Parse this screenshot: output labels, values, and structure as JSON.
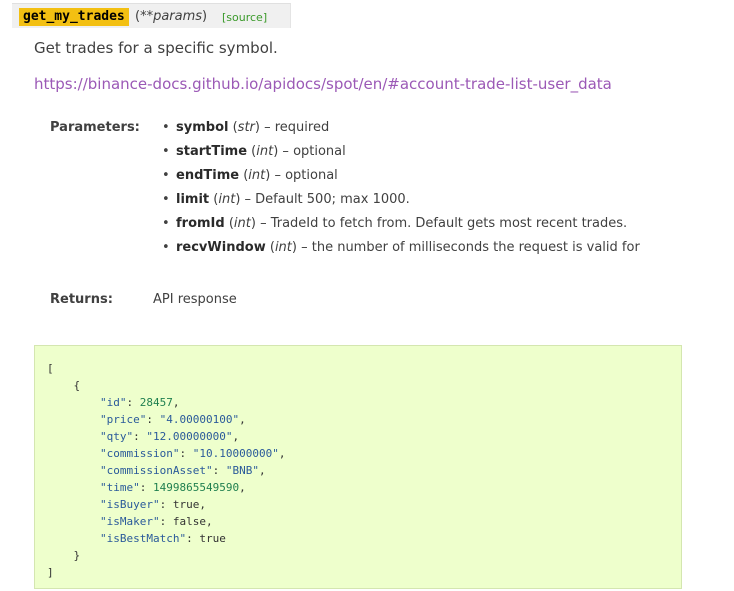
{
  "signature": {
    "name": "get_my_trades",
    "params_prefix": "(**",
    "params_name": "params",
    "params_suffix": ")",
    "source_label": "[source]"
  },
  "description": "Get trades for a specific symbol.",
  "doc_link": "https://binance-docs.github.io/apidocs/spot/en/#account-trade-list-user_data",
  "parameters_label": "Parameters:",
  "parameters": [
    {
      "name": "symbol",
      "type": "str",
      "desc": "required"
    },
    {
      "name": "startTime",
      "type": "int",
      "desc": "optional"
    },
    {
      "name": "endTime",
      "type": "int",
      "desc": "optional"
    },
    {
      "name": "limit",
      "type": "int",
      "desc": "Default 500; max 1000."
    },
    {
      "name": "fromId",
      "type": "int",
      "desc": "TradeId to fetch from. Default gets most recent trades."
    },
    {
      "name": "recvWindow",
      "type": "int",
      "desc": "the number of milliseconds the request is valid for"
    }
  ],
  "returns_label": "Returns:",
  "returns_value": "API response",
  "code_lines": [
    "[",
    "    {",
    "        \"id\": 28457,",
    "        \"price\": \"4.00000100\",",
    "        \"qty\": \"12.00000000\",",
    "        \"commission\": \"10.10000000\",",
    "        \"commissionAsset\": \"BNB\",",
    "        \"time\": 1499865549590,",
    "        \"isBuyer\": true,",
    "        \"isMaker\": false,",
    "        \"isBestMatch\": true",
    "    }",
    "]"
  ]
}
